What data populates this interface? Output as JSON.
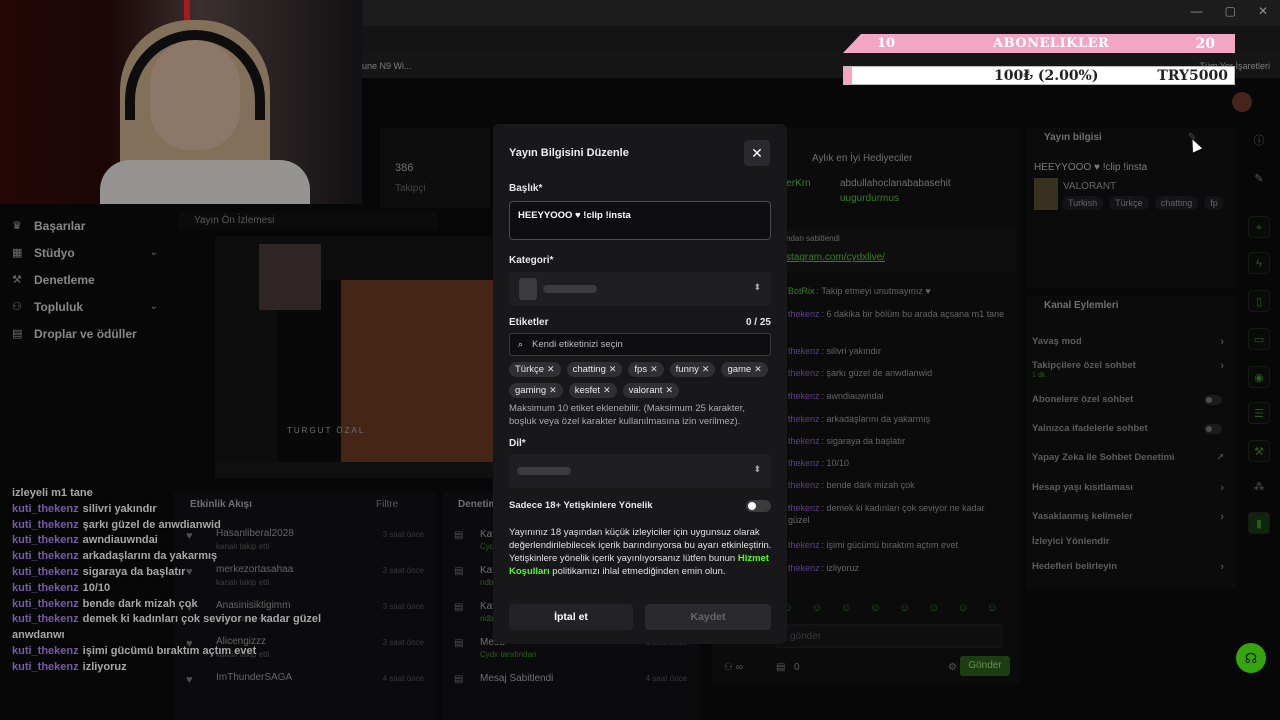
{
  "browser": {
    "bookmark_item": "une N9 Wi...",
    "bookmark_folder": "Tüm Yer İşaretleri",
    "window_controls": [
      "—",
      "▢",
      "✕"
    ]
  },
  "overlay": {
    "sub_goal_current": "10",
    "sub_goal_label": "ABONELIKLER",
    "sub_goal_target": "20",
    "donation_text": "100₺ (2.00%)",
    "donation_goal": "TRY5000",
    "donation_progress": 0.02,
    "accent_color": "#f3a6c2"
  },
  "nav": {
    "items": [
      {
        "label": "Başarılar",
        "icon": "trophy-icon",
        "chevron": false
      },
      {
        "label": "Stüdyo",
        "icon": "studio-icon",
        "chevron": true
      },
      {
        "label": "Denetleme",
        "icon": "wrench-icon",
        "chevron": false
      },
      {
        "label": "Topluluk",
        "icon": "users-icon",
        "chevron": true
      },
      {
        "label": "Droplar ve ödüller",
        "icon": "gift-icon",
        "chevron": false
      }
    ]
  },
  "stats": {
    "followers": "386",
    "followers_label": "Takipçi"
  },
  "preview": {
    "title": "Yayın Ön İzlemesi",
    "caption": "TURGUT ÖZAL"
  },
  "feed": {
    "title": "Etkinlik Akışı",
    "filter": "Filtre",
    "items": [
      {
        "name": "Hasanliberal2028",
        "action": "kanalı takip etti",
        "time": "3 saat önce"
      },
      {
        "name": "merkezortasahaa",
        "action": "kanalı takip etti",
        "time": "3 saat önce"
      },
      {
        "name": "Anasinisiktigimm",
        "action": "kanalı takip etti",
        "time": "3 saat önce"
      },
      {
        "name": "Alicengizzz",
        "action": "kanalı takip etti",
        "time": "3 saat önce"
      },
      {
        "name": "ImThunderSAGA",
        "action": "",
        "time": "4 saat önce"
      }
    ]
  },
  "pins": {
    "title": "Denetim",
    "items": [
      {
        "title": "Kate",
        "sub": "Cydx",
        "time": "3 saat önce"
      },
      {
        "title": "Kate",
        "sub": "ndbu",
        "time": "3 saat önce"
      },
      {
        "title": "Kate",
        "sub": "ndbu",
        "time": "3 saat önce"
      },
      {
        "title": "Mesa",
        "sub": "Cydx tarafından",
        "time": "3 saat önce"
      },
      {
        "title": "Mesaj Sabitlendi",
        "sub": "",
        "time": "4 saat önce"
      }
    ]
  },
  "chat_overlay": [
    {
      "user": "",
      "msg": "izleyeli m1 tane"
    },
    {
      "user": "kuti_thekenz",
      "msg": "silivri yakındır"
    },
    {
      "user": "kuti_thekenz",
      "msg": "şarkı güzel de anwdianwid"
    },
    {
      "user": "kuti_thekenz",
      "msg": "awndiauwndai"
    },
    {
      "user": "kuti_thekenz",
      "msg": "arkadaşlarını da yakarmış"
    },
    {
      "user": "kuti_thekenz",
      "msg": "sigaraya da başlatır"
    },
    {
      "user": "kuti_thekenz",
      "msg": "10/10"
    },
    {
      "user": "kuti_thekenz",
      "msg": "bende dark mizah çok"
    },
    {
      "user": "kuti_thekenz",
      "msg": "demek ki kadınları çok seviyor ne kadar güzel"
    },
    {
      "user": "",
      "msg": "anwdanwı"
    },
    {
      "user": "kuti_thekenz",
      "msg": "işimi gücümü bıraktım açtım evet"
    },
    {
      "user": "kuti_thekenz",
      "msg": "izliyoruz"
    }
  ],
  "chat": {
    "top_gifters_title": "Aylık en İyi Hediyeciler",
    "gifter_left": "lerKrn",
    "gifter1": "abdullahoclanababasehit",
    "gifter2": "uugurdurmus",
    "pinned_label": "ndan sabitlendi",
    "pinned_url": "stagram.com/cydxlive/",
    "messages": [
      {
        "user": "BotRix",
        "msg": ": Takip etmeyi unutmayınız ♥",
        "bot": true
      },
      {
        "user": "thekenz",
        "msg": ": 6 dakika bir bölüm bu arada açsana m1 tane",
        "bot": false
      },
      {
        "user": "thekenz",
        "msg": ": silivri yakındır",
        "bot": false
      },
      {
        "user": "thekenz",
        "msg": ": şarkı güzel de anwdianwid",
        "bot": false
      },
      {
        "user": "thekenz",
        "msg": ": awndiauwndai",
        "bot": false
      },
      {
        "user": "thekenz",
        "msg": ": arkadaşlarını da yakarmış",
        "bot": false
      },
      {
        "user": "thekenz",
        "msg": ": sigaraya da başlatır",
        "bot": false
      },
      {
        "user": "thekenz",
        "msg": ": 10/10",
        "bot": false
      },
      {
        "user": "thekenz",
        "msg": ": bende dark mizah çok",
        "bot": false
      },
      {
        "user": "thekenz",
        "msg": ": demek ki kadınları çok seviyor ne kadar güzel",
        "bot": false
      },
      {
        "user": "thekenz",
        "msg": ": işimi gücümü bıraktım açtım evet",
        "bot": false
      },
      {
        "user": "thekenz",
        "msg": ": izliyoruz",
        "bot": false
      }
    ],
    "input_placeholder": "j gönder",
    "points": "0",
    "send": "Gönder"
  },
  "stream_info": {
    "title": "Yayın bilgisi",
    "stream_title": "HEEYYOOO ♥ !clip !insta",
    "game": "VALORANT",
    "tags": [
      "Turkish",
      "Türkçe",
      "chatting",
      "fp"
    ]
  },
  "channel_actions": {
    "title": "Kanal Eylemleri",
    "rows": [
      {
        "label": "Yavaş mod",
        "sub": "",
        "control": "chevron"
      },
      {
        "label": "Takipçilere özel sohbet",
        "sub": "1 dk.",
        "control": "chevron"
      },
      {
        "label": "Abonelere özel sohbet",
        "sub": "",
        "control": "toggle"
      },
      {
        "label": "Yalnızca ifadelerle sohbet",
        "sub": "",
        "control": "toggle"
      },
      {
        "label": "Yapay Zeka ile Sohbet Denetimi",
        "sub": "",
        "control": "external"
      },
      {
        "label": "Hesap yaşı kısıtlaması",
        "sub": "",
        "control": "chevron"
      },
      {
        "label": "Yasaklanmış kelimeler",
        "sub": "",
        "control": "chevron"
      },
      {
        "label": "İzleyici Yönlendir",
        "sub": "",
        "control": "none"
      },
      {
        "label": "Hedefleri belirleyin",
        "sub": "",
        "control": "chevron"
      }
    ]
  },
  "modal": {
    "title": "Yayın Bilgisini Düzenle",
    "title_label": "Başlık*",
    "title_value": "HEEYYOOO ♥ !clip !insta",
    "category_label": "Kategori*",
    "tags_label": "Etiketler",
    "tags_count": "0 / 25",
    "tags_placeholder": "Kendi etiketinizi seçin",
    "tags": [
      "Türkçe",
      "chatting",
      "fps",
      "funny",
      "game",
      "gaming",
      "kesfet",
      "valorant"
    ],
    "tags_hint": "Maksimum 10 etiket eklenebilir. (Maksimum 25 karakter, boşluk veya özel karakter kullanılmasına izin verilmez).",
    "language_label": "Dil*",
    "adult_label": "Sadece 18+ Yetişkinlere Yönelik",
    "adult_enabled": false,
    "adult_desc_1": "Yayınınız 18 yaşından küçük izleyiciler için uygunsuz olarak değerlendirilebilecek içerik barındırıyorsa bu ayarı etkinleştirin. Yetişkinlere yönelik içerik yayınlıyorsanız lütfen bunun ",
    "adult_desc_link": "Hizmet Koşulları",
    "adult_desc_2": " politikamızı ihlal etmediğinden emin olun.",
    "cancel": "İptal et",
    "save": "Kaydet",
    "link_color": "#53fc18"
  }
}
